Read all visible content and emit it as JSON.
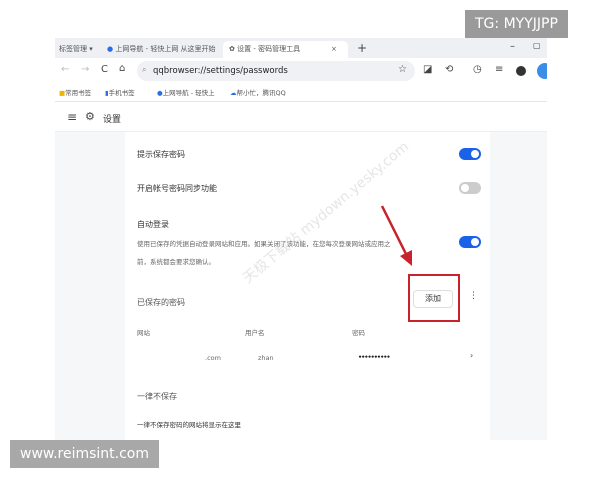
{
  "tabs": [
    {
      "label": "标签管理 ▾"
    },
    {
      "label": "上网导航 - 轻快上网 从这里开始"
    },
    {
      "label": "设置 - 密码管理工具"
    }
  ],
  "address_bar": {
    "value": "qqbrowser://settings/passwords"
  },
  "bookmarks": [
    {
      "label": "常用书签"
    },
    {
      "label": "手机书签"
    },
    {
      "label": "上网导航 - 轻快上"
    },
    {
      "label": "帮小忙，腾讯QQ"
    }
  ],
  "header": {
    "title": "设置"
  },
  "settings": {
    "offer_save": {
      "label": "提示保存密码",
      "enabled": true
    },
    "sync": {
      "label": "开启帐号密码同步功能",
      "enabled": false
    },
    "auto_signin": {
      "label": "自动登录",
      "desc1": "使用已保存的凭据自动登录网站和应用。如果关闭了该功能，在您每次登录网站或应用之",
      "desc2": "前，系统都会要求您确认。",
      "enabled": true
    }
  },
  "saved": {
    "title": "已保存的密码",
    "add_label": "添加",
    "columns": [
      "网站",
      "用户名",
      "密码"
    ],
    "rows": [
      {
        "site": ".com",
        "user": "zhan",
        "password": "••••••••••"
      }
    ]
  },
  "never_saved": {
    "title": "一律不保存",
    "empty": "一律不保存密码的网站将显示在这里"
  },
  "watermarks": {
    "top": "TG: MYYJJPP",
    "bottom": "www.reimsint.com",
    "diagonal": "天极下载站 mydown.yesky.com"
  },
  "colors": {
    "accent": "#1a62e8",
    "annotation": "#c8232c"
  }
}
